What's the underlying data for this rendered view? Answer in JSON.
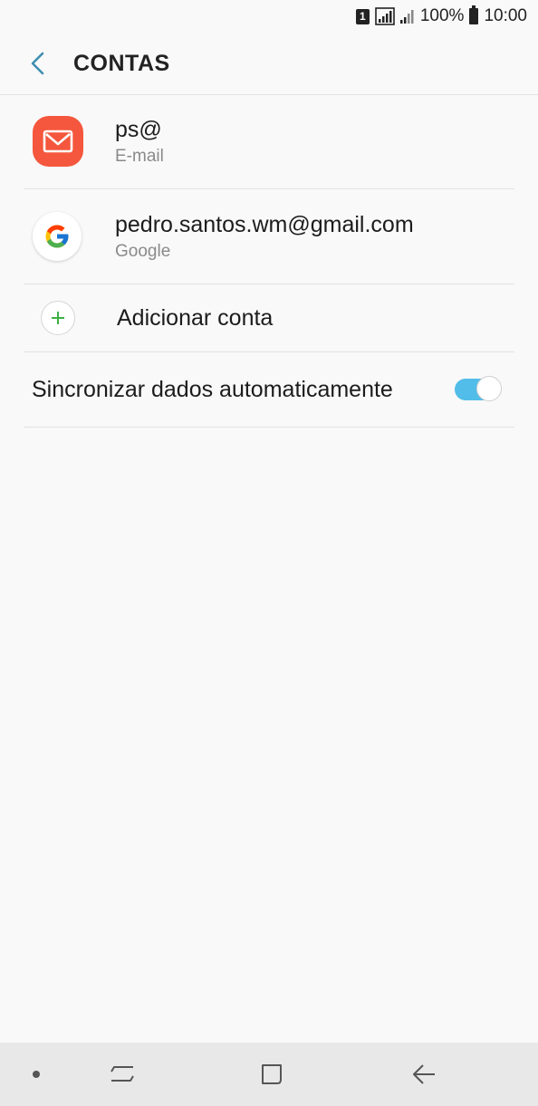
{
  "status_bar": {
    "sim_label": "1",
    "battery": "100%",
    "time": "10:00",
    "icons": [
      "sim-1-icon",
      "signal-icon",
      "signal-icon",
      "battery-icon"
    ]
  },
  "header": {
    "back_icon": "chevron-left-icon",
    "title": "CONTAS"
  },
  "accounts": [
    {
      "name": "ps@",
      "type": "E-mail",
      "icon": "email-icon"
    },
    {
      "name": "pedro.santos.wm@gmail.com",
      "type": "Google",
      "icon": "google-icon"
    }
  ],
  "add_account": {
    "label": "Adicionar conta",
    "icon": "plus-icon"
  },
  "sync": {
    "label": "Sincronizar dados automaticamente",
    "enabled": true
  },
  "nav_bar": {
    "buttons": [
      "dot-icon",
      "recents-icon",
      "home-icon",
      "back-arrow-icon"
    ]
  },
  "colors": {
    "accent": "#52bde8",
    "email_icon_bg": "#f4573d",
    "plus_green": "#3cb043",
    "back_chevron": "#3d8fb0"
  }
}
